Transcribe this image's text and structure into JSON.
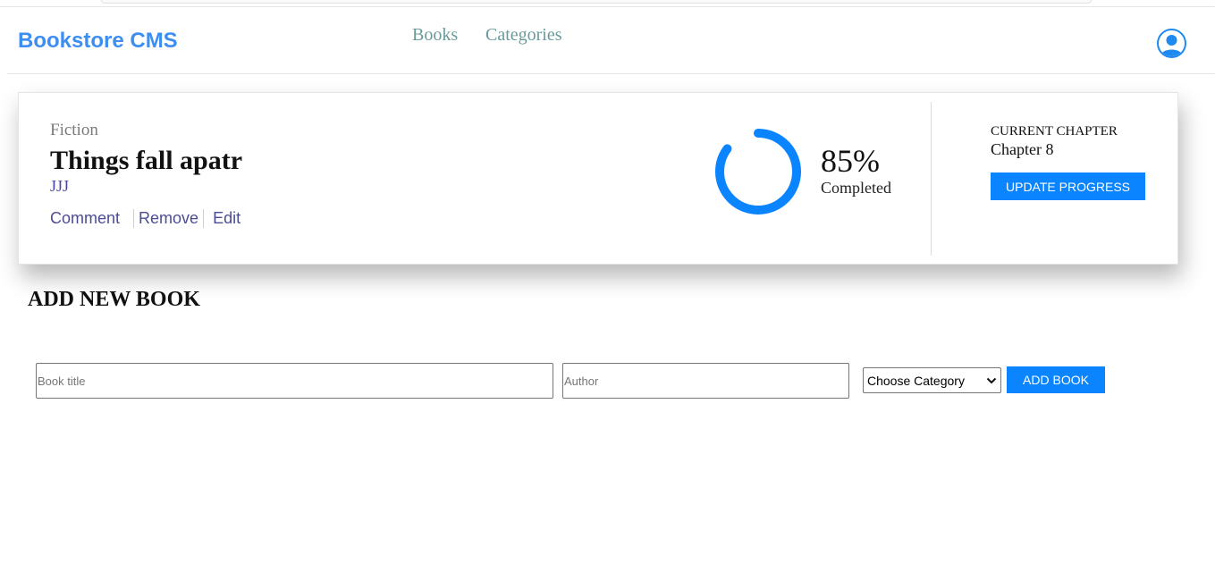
{
  "app": {
    "brand": "Bookstore CMS"
  },
  "nav": {
    "links": [
      "Books",
      "Categories"
    ]
  },
  "icons": {
    "avatar": "user-avatar-icon",
    "select_arrow": "chevron-down-icon"
  },
  "colors": {
    "brand": "#3e8ef2",
    "accent": "#0a84ff",
    "progress": "#0a84ff",
    "nav_link": "#6a9a9a"
  },
  "book": {
    "genre": "Fiction",
    "title": "Things fall apatr",
    "author": "JJJ",
    "actions": {
      "comment": "Comment",
      "remove": "Remove",
      "edit": "Edit"
    },
    "progress": {
      "percent_label": "85%",
      "percent_value": 85,
      "status": "Completed"
    },
    "chapter": {
      "heading": "CURRENT CHAPTER",
      "value": "Chapter 8"
    },
    "update_button": "UPDATE PROGRESS"
  },
  "add_form": {
    "heading": "ADD NEW BOOK",
    "title_placeholder": "Book title",
    "author_placeholder": "Author",
    "category_selected": "Choose Category",
    "submit_label": "ADD BOOK"
  }
}
